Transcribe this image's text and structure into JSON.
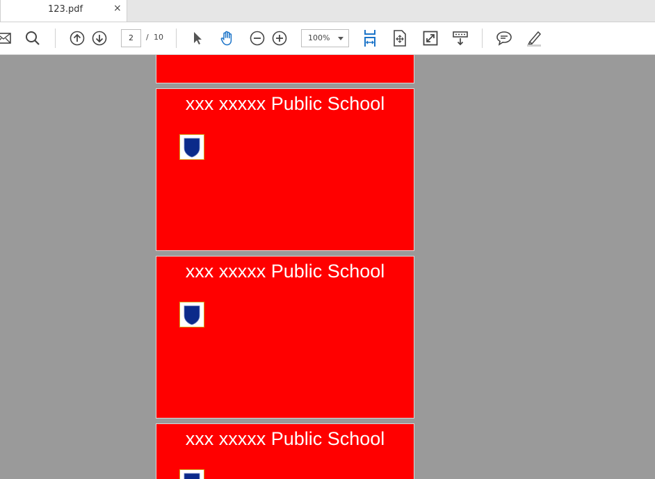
{
  "tab": {
    "title": "123.pdf",
    "close_glyph": "×"
  },
  "toolbar": {
    "icons": [
      "mail-icon",
      "search-icon",
      "previous-page-icon",
      "next-page-icon",
      "select-cursor-icon",
      "hand-tool-icon",
      "zoom-out-icon",
      "zoom-in-icon",
      "fit-width-icon",
      "fit-page-icon",
      "full-screen-icon",
      "read-mode-icon",
      "comment-icon",
      "highlight-icon"
    ],
    "current_page": "2",
    "page_separator": "/",
    "total_pages": "10",
    "zoom": "100%"
  },
  "colors": {
    "page_background": "#ff0000",
    "viewer_background": "#9a9a9a",
    "active_tool": "#1a73c8",
    "crest_shield": "#0b2a8a"
  },
  "pages": [
    {
      "heading": ""
    },
    {
      "heading": "xxx xxxxx Public School"
    },
    {
      "heading": "xxx xxxxx Public School"
    },
    {
      "heading": "xxx xxxxx Public School"
    }
  ]
}
